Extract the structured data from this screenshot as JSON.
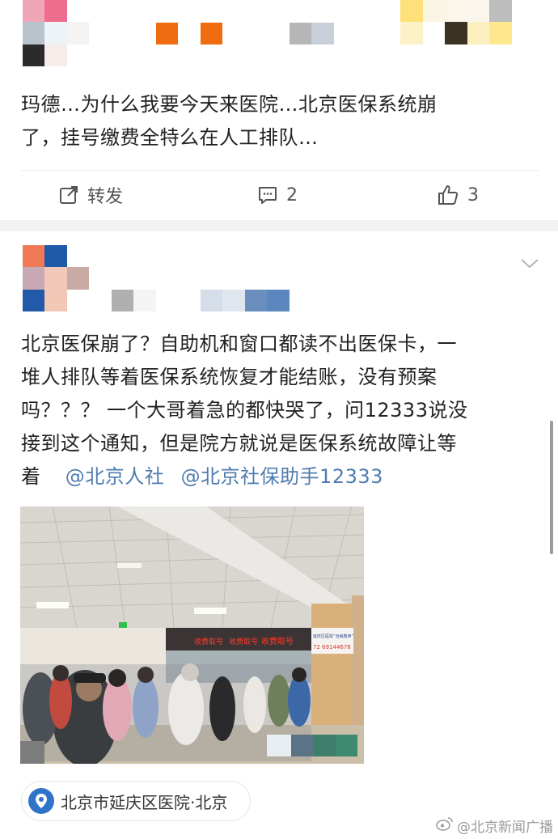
{
  "post1": {
    "text_line1": "玛德…为什么我要今天来医院…北京医保系统崩",
    "text_line2": "了，挂号缴费全特么在人工排队…",
    "actions": {
      "repost_label": "转发",
      "comment_count": "2",
      "like_count": "3"
    }
  },
  "post2": {
    "text_lines": [
      "北京医保崩了？自助机和窗口都读不出医保卡，一",
      "堆人排队等着医保系统恢复才能结账，没有预案",
      "吗？？？ 一个大哥着急的都快哭了，问12333说没",
      "接到这个通知，但是院方就说是医保系统故障让等"
    ],
    "last_line_prefix": "着",
    "mentions": [
      "@北京人社",
      "@北京社保助手12333"
    ],
    "photo": {
      "sign_left": "收费取号",
      "sign_mid": "收费取号",
      "sign_right": "收费取号",
      "side_sign_title": "延庆区医院“治病救命”",
      "side_sign_phone": "72 69144678"
    },
    "location": {
      "place": "北京市延庆区医院",
      "city": "·北京"
    }
  },
  "watermark": "@北京新闻广播",
  "colors": {
    "mention": "#4f7cb0",
    "pin": "#2f74c9",
    "text": "#222222",
    "action": "#555555"
  },
  "icons": [
    "repost-icon",
    "comment-icon",
    "like-icon",
    "chevron-down-icon",
    "location-pin-icon",
    "weibo-icon"
  ]
}
